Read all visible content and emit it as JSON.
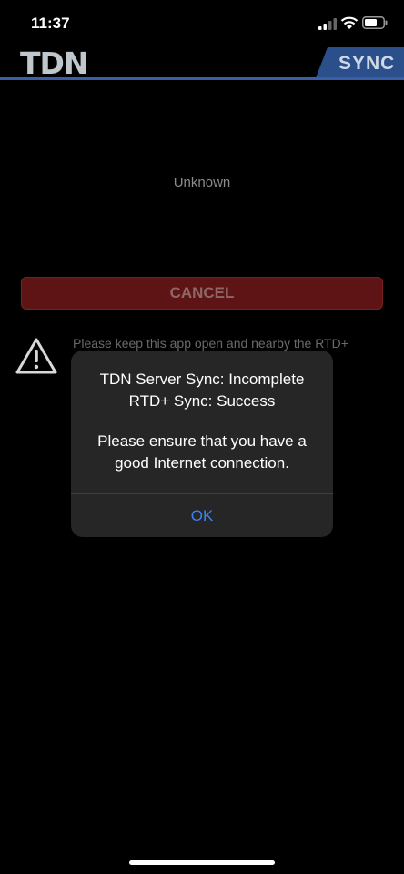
{
  "status_bar": {
    "time": "11:37"
  },
  "header": {
    "logo_text": "TDN",
    "sync_tab": "SYNC"
  },
  "sync": {
    "status": "Unknown",
    "cancel_label": "CANCEL",
    "warning": "Please keep this app open and nearby the RTD+"
  },
  "dialog": {
    "line1": "TDN Server Sync: Incomplete",
    "line2": "RTD+ Sync: Success",
    "line3": "Please ensure that you have a",
    "line4": "good Internet connection.",
    "ok_label": "OK"
  },
  "colors": {
    "accent_blue": "#3a5ea8",
    "cancel_red": "#5e1414",
    "ok_blue": "#3a82f7"
  }
}
